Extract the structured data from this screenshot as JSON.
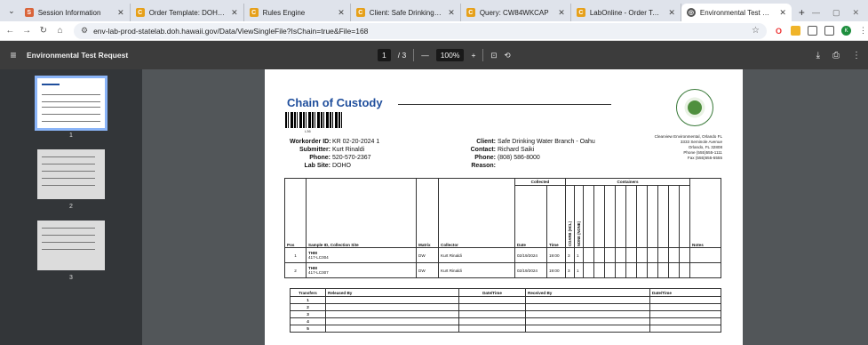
{
  "browser": {
    "tabs": [
      {
        "title": "Session Information",
        "favicon_color": "#d9643a",
        "active": false
      },
      {
        "title": "Order Template: DOH_ENV_DE/",
        "favicon_color": "#e6a01a",
        "active": false
      },
      {
        "title": "Rules Engine",
        "favicon_color": "#e6a01a",
        "active": false
      },
      {
        "title": "Client: Safe Drinking Water Bra",
        "favicon_color": "#e6a01a",
        "active": false
      },
      {
        "title": "Query: CW84WKCAP",
        "favicon_color": "#e6a01a",
        "active": false
      },
      {
        "title": "LabOnline - Order Tests",
        "favicon_color": "#e6a01a",
        "active": false
      },
      {
        "title": "Environmental Test Request",
        "favicon_color": "#555555",
        "active": true
      }
    ],
    "url": "env-lab-prod-statelab.doh.hawaii.gov/Data/ViewSingleFile?IsChain=true&File=168"
  },
  "pdf": {
    "title": "Environmental Test Request",
    "page_current": "1",
    "page_total": "/ 3",
    "zoom": "100%",
    "thumbnails": [
      "1",
      "2",
      "3"
    ]
  },
  "doc": {
    "title": "Chain of Custody",
    "barcode_text": "L36",
    "workorder_label": "Workorder ID:",
    "workorder": "KR 02-20-2024 1",
    "submitter_label": "Submitter:",
    "submitter": "Kurt Rinaldi",
    "phone_label": "Phone:",
    "phone": "520-570-2367",
    "labsite_label": "Lab Site:",
    "labsite": "DOHO",
    "client_label": "Client:",
    "client": "Safe Drinking Water Branch - Oahu",
    "contact_label": "Contact:",
    "contact": "Richard Saiki",
    "client_phone_label": "Phone:",
    "client_phone": "(808) 586-8000",
    "reason_label": "Reason:",
    "reason": "",
    "lab_address": [
      "Clearview Environmental, Orlando FL",
      "3333 Seminole Avenue",
      "Orlando, FL 32808",
      "Phone (555)555-1111",
      "Fax (555)555-5555"
    ],
    "sample_table": {
      "group_collected": "Collected",
      "group_containers": "Containers",
      "headers": [
        "Pos",
        "Sample ID, Collection Site",
        "Matrix",
        "Collector",
        "Date",
        "Time",
        "COARB (HCL)",
        "NONE (NONE)",
        "Notes"
      ],
      "rows": [
        {
          "pos": "1",
          "id": "THM",
          "site": "417-LC004",
          "matrix": "DW",
          "collector": "Kurt Rinaldi",
          "date": "02/19/2024",
          "time": "19:00",
          "c1": "3",
          "c2": "1"
        },
        {
          "pos": "2",
          "id": "THM",
          "site": "417-LC007",
          "matrix": "DW",
          "collector": "Kurt Rinaldi",
          "date": "02/19/2024",
          "time": "19:00",
          "c1": "3",
          "c2": "1"
        }
      ]
    },
    "transfer_table": {
      "headers": [
        "Transfers",
        "Released By",
        "Date/Time",
        "Received By",
        "Date/Time"
      ],
      "rows": [
        "1",
        "2",
        "3",
        "4",
        "5"
      ]
    }
  }
}
